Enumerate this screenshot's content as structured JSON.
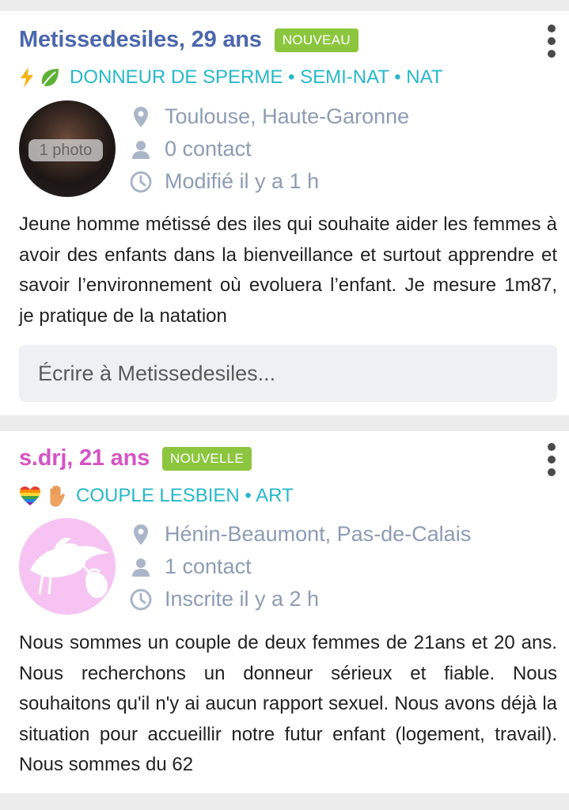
{
  "profiles": [
    {
      "name_age": "Metissedesiles, 29 ans",
      "badge": "NOUVEAU",
      "tag_icons": [
        "lightning-icon",
        "leaf-icon"
      ],
      "tags": "DONNEUR DE SPERME • SEMI-NAT • NAT",
      "avatar_label": "1 photo",
      "location": "Toulouse, Haute-Garonne",
      "contacts": "0 contact",
      "updated": "Modifié il y a 1 h",
      "description": "Jeune homme métissé des iles qui souhaite aider les femmes à avoir des enfants dans la bienveillance et surtout apprendre et savoir l’environnement où evoluera l’enfant. Je mesure 1m87, je pratique de la natation",
      "reply_placeholder": "Écrire à Metissedesiles..."
    },
    {
      "name_age": "s.drj, 21 ans",
      "badge": "NOUVELLE",
      "tag_icons": [
        "rainbow-heart-icon",
        "hand-icon"
      ],
      "tags": "COUPLE LESBIEN • ART",
      "location": "Hénin-Beaumont, Pas-de-Calais",
      "contacts": "1 contact",
      "updated": "Inscrite il y a 2 h",
      "description": "Nous sommes un couple de deux femmes de 21ans et 20 ans. Nous recherchons un donneur sérieux et fiable. Nous souhaitons qu'il n'y ai aucun rapport sexuel. Nous avons déjà la situation pour accueillir notre futur enfant (logement, travail). Nous sommes du 62"
    }
  ],
  "colors": {
    "male_name": "#4b67ad",
    "female_name": "#d553c4",
    "badge": "#8cc63f",
    "tags": "#27b8c8",
    "meta": "#8d9cb4"
  }
}
